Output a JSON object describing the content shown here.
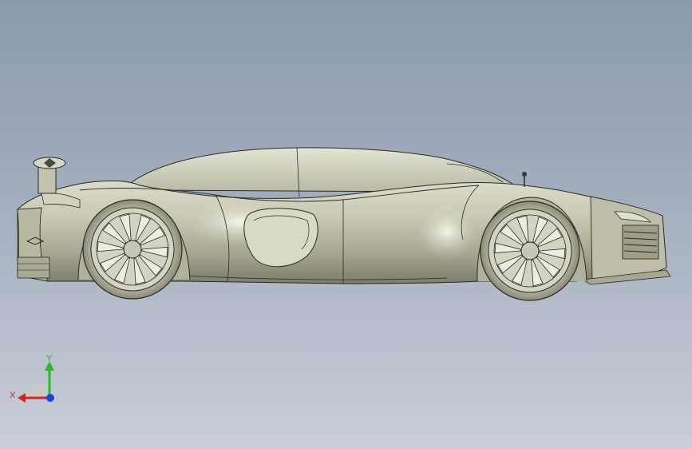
{
  "viewport": {
    "background_top": "#8c9aae",
    "background_bottom": "#c9ced8"
  },
  "model": {
    "body_color": "#c9c9b4",
    "shadow_color": "#8f8f7c",
    "highlight_color": "#eeeee3",
    "line_color": "#2a2a2a"
  },
  "triad": {
    "x_label": "X",
    "y_label": "Y",
    "x_color": "#e02020",
    "y_color": "#20c020",
    "z_color": "#2040e0"
  }
}
